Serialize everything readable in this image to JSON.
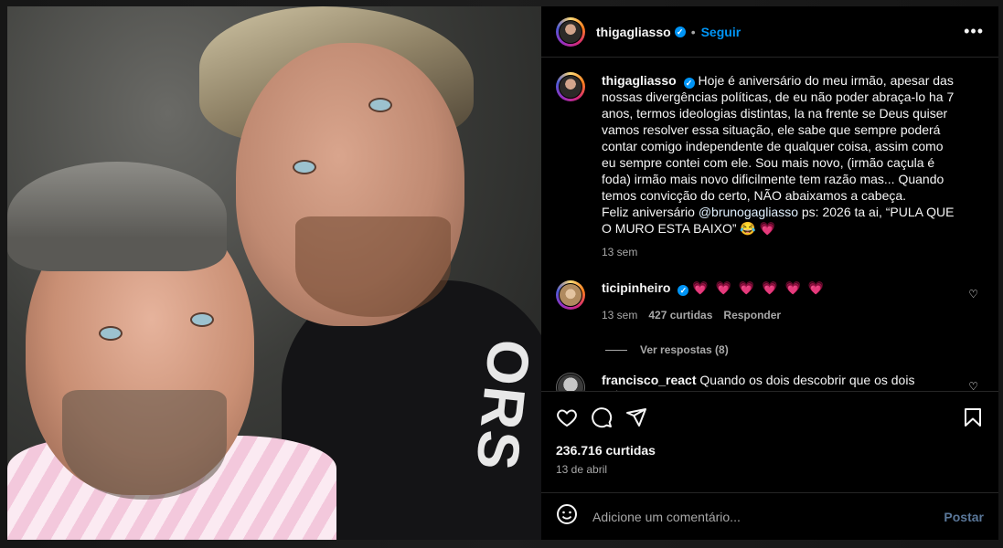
{
  "post": {
    "author": "thigagliasso",
    "follow_label": "Seguir",
    "separator": "•"
  },
  "caption": {
    "username": "thigagliasso",
    "text": "Hoje é aniversário do meu irmão, apesar das nossas divergências políticas, de eu não poder abraça-lo ha 7 anos, termos ideologias distintas, la na frente se Deus quiser vamos resolver essa situação, ele sabe que sempre poderá contar comigo independente de qualquer coisa, assim como eu sempre contei com ele. Sou mais novo, (irmão caçula é foda) irmão mais novo dificilmente tem razão mas... Quando temos convicção do certo, NÃO abaixamos a cabeça.",
    "line2_prefix": "Feliz aniversário",
    "mention": "@brunogagliasso",
    "line2_suffix": "ps: 2026 ta ai, “PULA QUE O MURO ESTA BAIXO” 😂 💗",
    "age": "13 sem"
  },
  "comments": [
    {
      "username": "ticipinheiro",
      "text": "💗 💗 💗 💗 💗 💗",
      "age": "13 sem",
      "likes": "427 curtidas",
      "reply_label": "Responder",
      "view_replies": "Ver respostas (8)"
    },
    {
      "username": "francisco_react",
      "text": "Quando os dois descobrir que os dois estavam"
    }
  ],
  "stats": {
    "likes": "236.716 curtidas",
    "date": "13 de abril"
  },
  "composer": {
    "placeholder": "Adicione um comentário...",
    "post_label": "Postar"
  },
  "photo": {
    "hoodie_text": "ORS"
  },
  "colors": {
    "accent": "#0095f6",
    "background": "#000000",
    "muted": "#a8a8a8",
    "heart": "#ff3d6e"
  }
}
